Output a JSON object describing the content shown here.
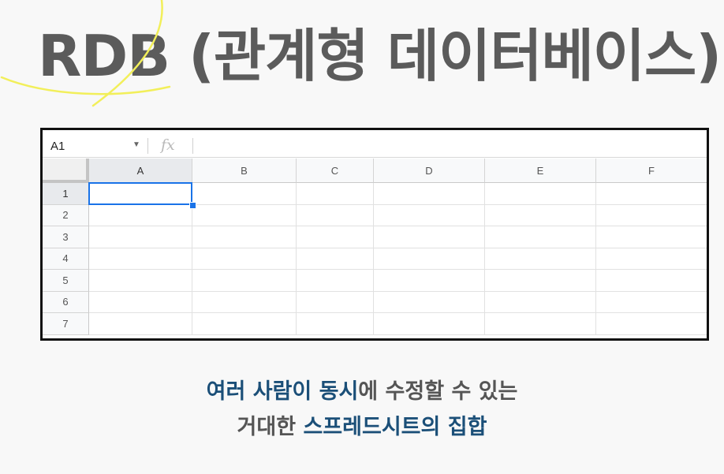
{
  "title": "RDB (관계형 데이터베이스)",
  "highlight_color": "#f2ef5a",
  "formula_bar": {
    "name_box": "A1",
    "fx_symbol": "fx",
    "formula_value": ""
  },
  "columns": [
    "A",
    "B",
    "C",
    "D",
    "E",
    "F"
  ],
  "rows": [
    "1",
    "2",
    "3",
    "4",
    "5",
    "6",
    "7"
  ],
  "selected_cell": "A1",
  "selection_color": "#1a73e8",
  "caption": {
    "line1_em": "여러 사람이 동시",
    "line1_rest": "에 수정할 수 있는",
    "line2_plain": "거대한 ",
    "line2_em": "스프레드시트의 집합"
  }
}
